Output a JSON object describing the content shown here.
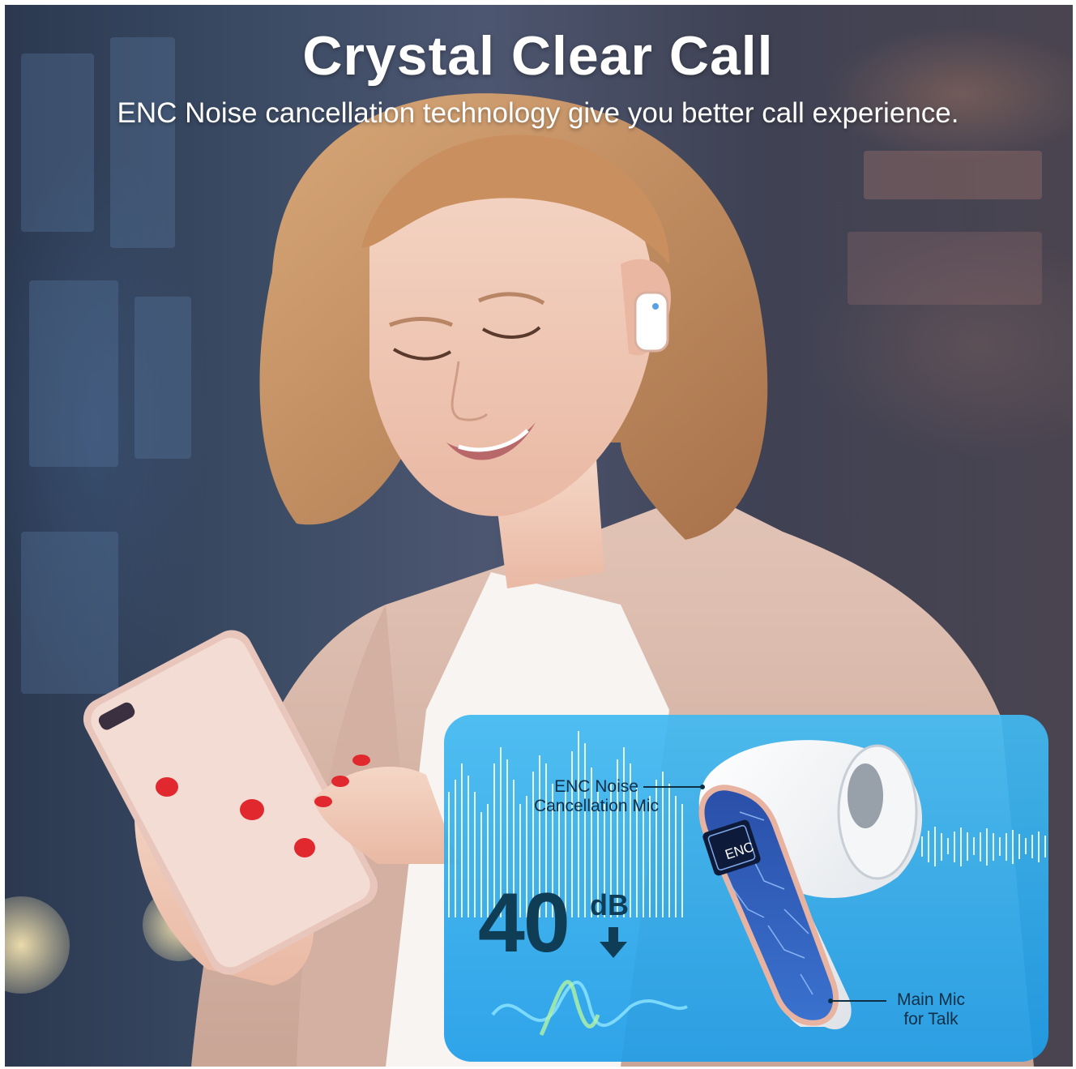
{
  "headline": "Crystal Clear Call",
  "subheadline": "ENC Noise cancellation technology give you better call experience.",
  "callouts": {
    "enc_mic": [
      "ENC Noise",
      "Cancellation Mic"
    ],
    "main_mic": [
      "Main Mic",
      "for Talk"
    ]
  },
  "chip_label": "ENC",
  "noise_reduction": {
    "value": "40",
    "unit": "dB"
  },
  "colors": {
    "panel": "#2ea8ea",
    "callout_text": "#0f2f45",
    "earbud_trim": "#e9b3a2",
    "circuit": "#2c5cb8"
  }
}
